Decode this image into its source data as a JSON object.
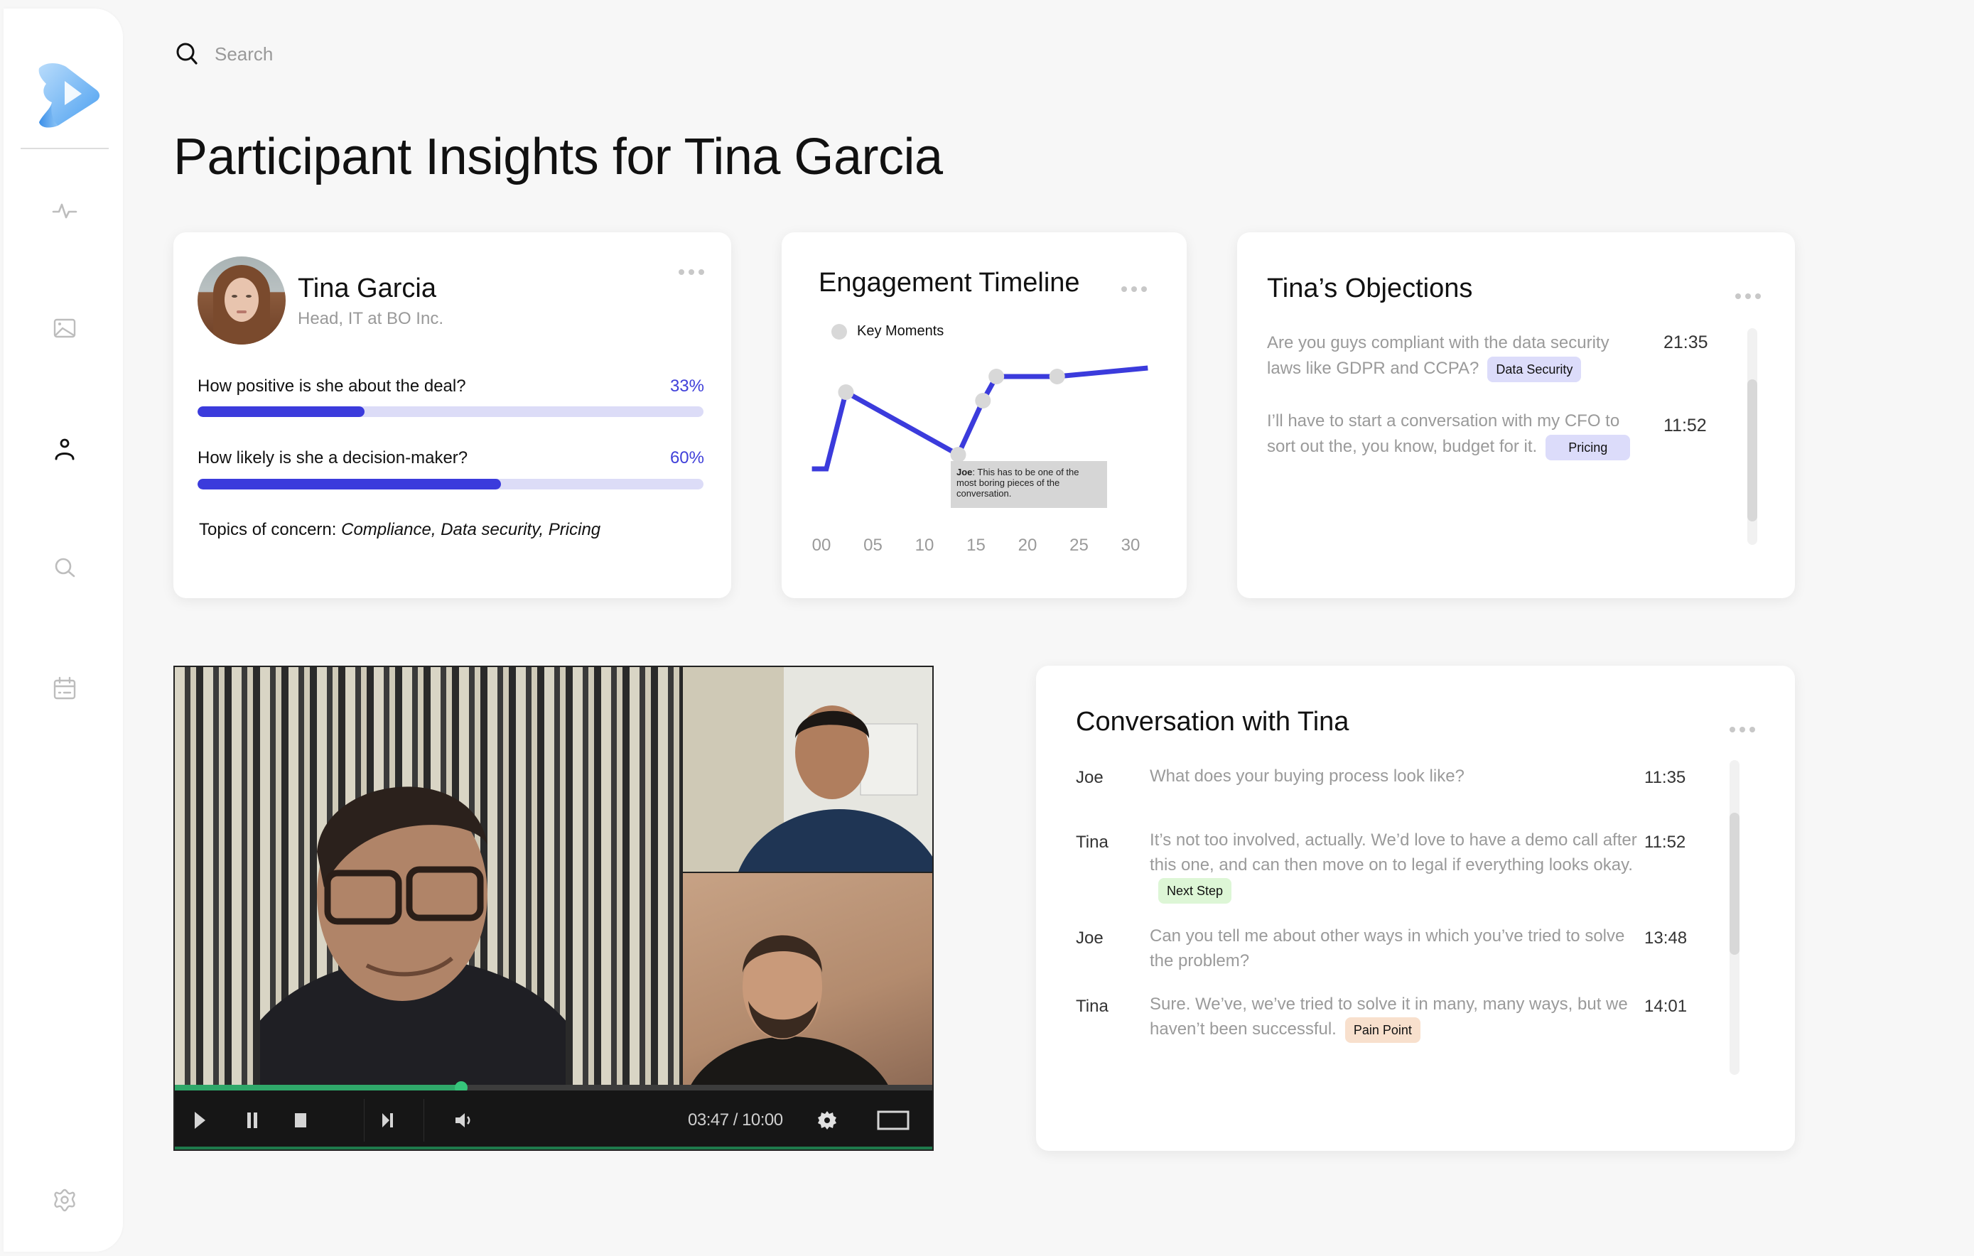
{
  "app": {
    "brand_color": "#4a9ff0"
  },
  "sidebar": {
    "items": [
      {
        "icon": "activity-icon",
        "active": false
      },
      {
        "icon": "image-icon",
        "active": false
      },
      {
        "icon": "person-icon",
        "active": true
      },
      {
        "icon": "search-icon",
        "active": false
      },
      {
        "icon": "calendar-icon",
        "active": false
      }
    ],
    "footer_icon": "settings-icon"
  },
  "search": {
    "placeholder": "Search",
    "value": ""
  },
  "page": {
    "title": "Participant Insights for Tina Garcia"
  },
  "profile": {
    "name": "Tina Garcia",
    "role": "Head, IT at BO Inc.",
    "metrics": [
      {
        "question": "How positive is she about the deal?",
        "value_label": "33%",
        "value": 33
      },
      {
        "question": "How likely is she a decision-maker?",
        "value_label": "60%",
        "value": 60
      }
    ],
    "topics_label": "Topics of concern:",
    "topics": "Compliance, Data security, Pricing",
    "accent_color": "#3b3bdc",
    "track_color": "#dcdcf7"
  },
  "timeline": {
    "title": "Engagement Timeline",
    "legend": "Key Moments",
    "tooltip": {
      "speaker": "Joe",
      "text": ": This has to be one of the most boring pieces of the conversation."
    }
  },
  "chart_data": {
    "type": "line",
    "title": "Engagement Timeline",
    "xlabel": "",
    "ylabel": "",
    "x_ticks": [
      "00",
      "05",
      "10",
      "15",
      "20",
      "25",
      "30"
    ],
    "xlim": [
      -1.2,
      31.5
    ],
    "ylim": [
      0,
      100
    ],
    "grid": false,
    "legend": {
      "position": "top-left",
      "entries": [
        "Key Moments"
      ]
    },
    "series": [
      {
        "name": "Engagement",
        "color": "#3b3bdc",
        "points": [
          {
            "x": -1.2,
            "y": 20
          },
          {
            "x": 0.2,
            "y": 20
          },
          {
            "x": 2.1,
            "y": 74
          },
          {
            "x": 13.0,
            "y": 30
          },
          {
            "x": 15.4,
            "y": 68
          },
          {
            "x": 16.7,
            "y": 85
          },
          {
            "x": 22.6,
            "y": 85
          },
          {
            "x": 31.4,
            "y": 91
          }
        ]
      }
    ],
    "key_moments": [
      {
        "x": 2.1,
        "y": 74
      },
      {
        "x": 13.0,
        "y": 30
      },
      {
        "x": 15.4,
        "y": 68
      },
      {
        "x": 16.7,
        "y": 85
      },
      {
        "x": 22.6,
        "y": 85
      }
    ],
    "annotations": [
      {
        "x": 13.0,
        "text": "Joe: This has to be one of the most boring pieces of the conversation."
      }
    ]
  },
  "objections": {
    "title": "Tina’s Objections",
    "items": [
      {
        "text": "Are you guys compliant with the data security laws like GDPR and CCPA?",
        "tag": "Data Security",
        "time": "21:35"
      },
      {
        "text": "I’ll have to start a conversation with my CFO to sort out the, you know, budget for it.",
        "tag": "Pricing",
        "time": "11:52"
      }
    ]
  },
  "video": {
    "time_readout": "03:47 / 10:00",
    "progress": 0.378,
    "controls": [
      "play",
      "pause",
      "stop",
      "skip-next",
      "volume",
      "settings",
      "fullscreen"
    ]
  },
  "conversation": {
    "title": "Conversation with Tina",
    "messages": [
      {
        "speaker": "Joe",
        "text": "What does your buying process look like?",
        "time": "11:35",
        "tag": null
      },
      {
        "speaker": "Tina",
        "text": "It’s not too involved, actually. We’d love to have a demo call after this one, and can then move on to legal if everything looks okay.",
        "time": "11:52",
        "tag": "Next Step"
      },
      {
        "speaker": "Joe",
        "text": "Can you tell me about other ways in which you’ve tried to solve the problem?",
        "time": "13:48",
        "tag": null
      },
      {
        "speaker": "Tina",
        "text": "Sure. We’ve, we’ve tried to solve it in many, many ways, but we haven’t been successful.",
        "time": "14:01",
        "tag": "Pain Point"
      }
    ]
  }
}
